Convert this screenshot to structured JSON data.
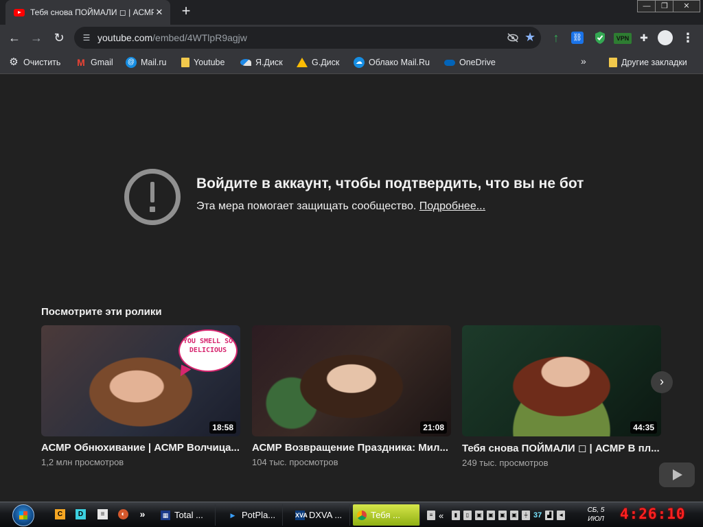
{
  "browser": {
    "tab": {
      "title": "Тебя снова ПОЙМАЛИ ◻ | АСМР В пл"
    },
    "window_controls": {
      "minimize": "—",
      "maximize": "❐",
      "close": "✕"
    },
    "newtab_symbol": "+",
    "omnibox": {
      "host": "youtube.com",
      "path": "/embed/4WTlpR9agjw"
    },
    "extensions": {
      "vpn_label": "VPN"
    }
  },
  "bookmarks": {
    "items": [
      {
        "label": "Очистить",
        "icon": "gear-icon"
      },
      {
        "label": "Gmail",
        "icon": "gmail-icon"
      },
      {
        "label": "Mail.ru",
        "icon": "mailru-icon"
      },
      {
        "label": "Youtube",
        "icon": "folder-icon"
      },
      {
        "label": "Я.Диск",
        "icon": "yandex-disk-icon"
      },
      {
        "label": "G.Диск",
        "icon": "google-drive-icon"
      },
      {
        "label": "Облако Mail.Ru",
        "icon": "cloud-icon"
      },
      {
        "label": "OneDrive",
        "icon": "onedrive-icon"
      }
    ],
    "more_symbol": "»",
    "other": "Другие закладки"
  },
  "page": {
    "message": {
      "title": "Войдите в аккаунт, чтобы подтвердить, что вы не бот",
      "subtitle": "Эта мера помогает защищать сообщество.",
      "learn_more": "Подробнее..."
    },
    "recommendations": {
      "heading": "Посмотрите эти ролики",
      "videos": [
        {
          "title": "АСМР Обнюхивание | АСМР Волчица...",
          "views": "1,2 млн просмотров",
          "duration": "18:58",
          "overlay_text": "YOU SMELL SO DELICIOUS"
        },
        {
          "title": "АСМР Возвращение Праздника: Мил...",
          "views": "104 тыс. просмотров",
          "duration": "21:08"
        },
        {
          "title": "Тебя снова ПОЙМАЛИ ◻ | АСМР В пл...",
          "views": "249 тыс. просмотров",
          "duration": "44:35"
        }
      ],
      "next_symbol": "›"
    }
  },
  "taskbar": {
    "quick_launch": {
      "c": "C",
      "d": "D",
      "more": "»"
    },
    "tasks": [
      {
        "label": "Total ...",
        "icon": "total-commander-icon"
      },
      {
        "label": "PotPla...",
        "icon": "potplayer-icon"
      },
      {
        "label": "DXVA ...",
        "icon": "dxva-icon"
      },
      {
        "label": "Тебя ...",
        "icon": "chrome-icon"
      }
    ],
    "tray": {
      "chevron": "«",
      "number": "37"
    },
    "date": {
      "line1": "СБ, 5",
      "line2": "ИЮЛ"
    },
    "clock": "4:26:10"
  },
  "colors": {
    "page_bg": "#212121",
    "toolbar_bg": "#35363a",
    "accent_star": "#8ab4f8",
    "clock_red": "#ff2020"
  }
}
